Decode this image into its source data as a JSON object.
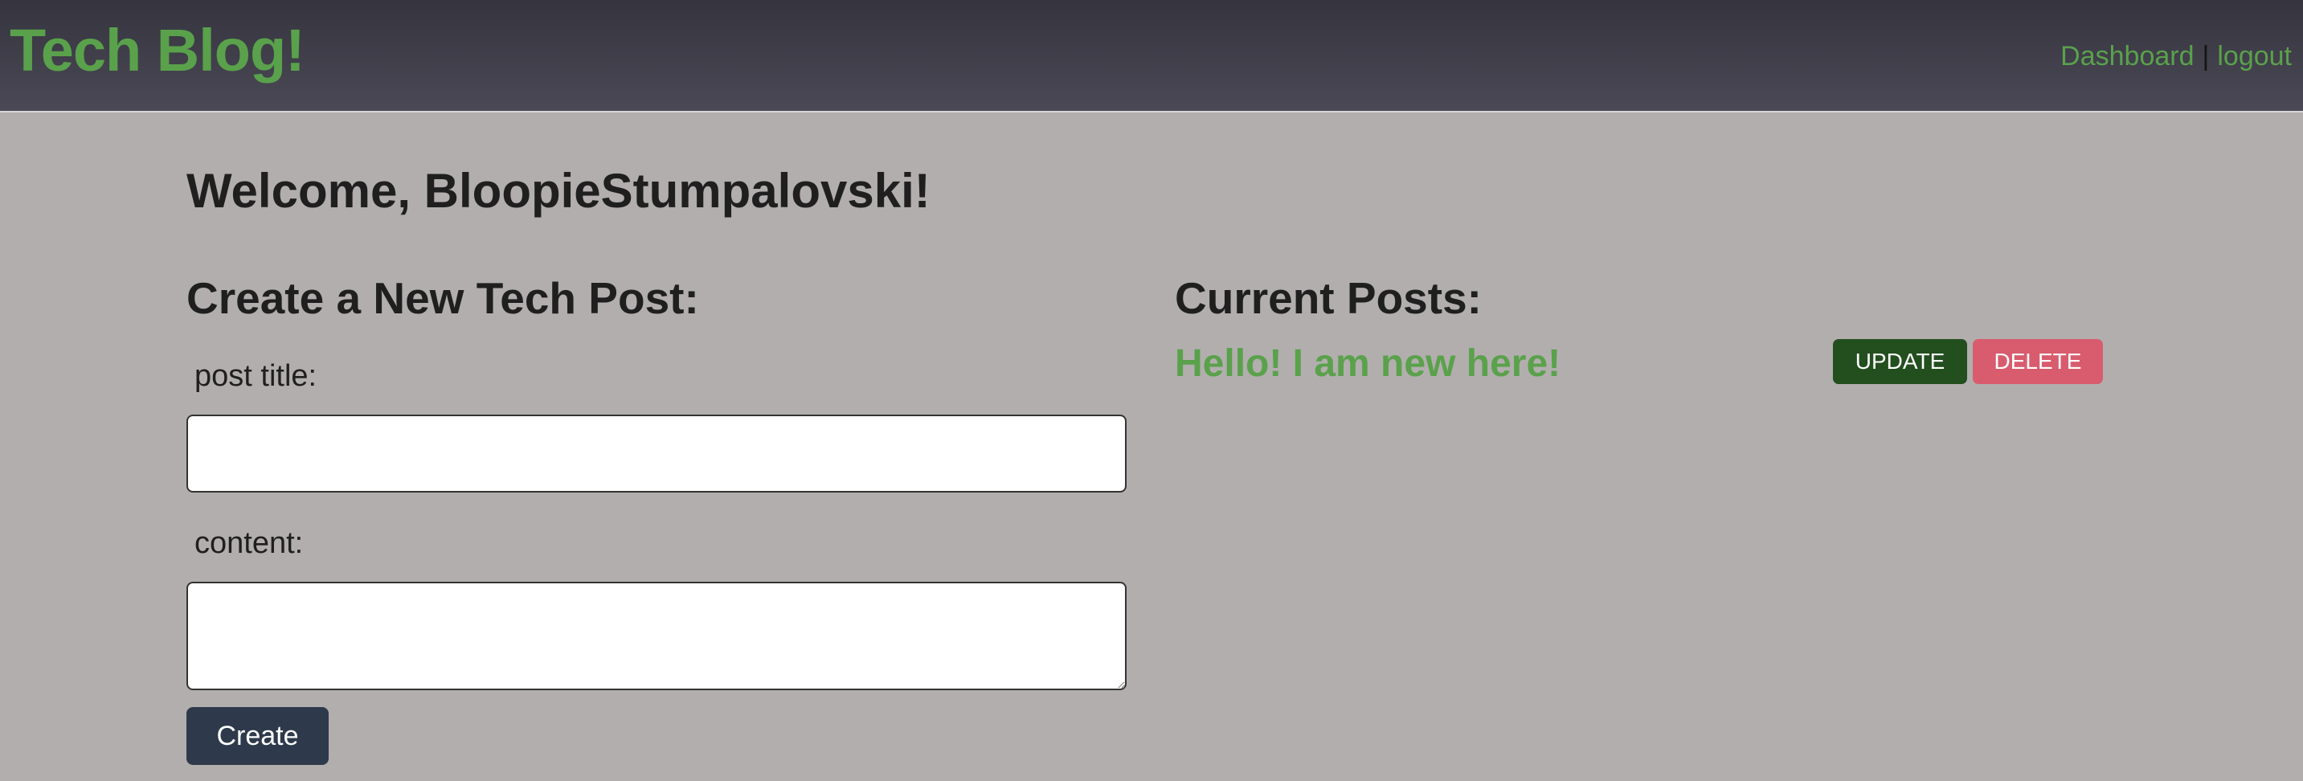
{
  "header": {
    "brand": "Tech Blog!",
    "nav": {
      "dashboard": "Dashboard",
      "separator": "|",
      "logout": "logout"
    }
  },
  "main": {
    "welcome": "Welcome, BloopieStumpalovski!",
    "create_section": {
      "heading": "Create a New Tech Post:",
      "title_label": "post title:",
      "title_value": "",
      "content_label": "content:",
      "content_value": "",
      "submit_label": "Create"
    },
    "posts_section": {
      "heading": "Current Posts:",
      "posts": [
        {
          "title": "Hello! I am new here!",
          "update_label": "UPDATE",
          "delete_label": "DELETE"
        }
      ]
    }
  },
  "colors": {
    "accent_green": "#5aa14b",
    "header_bg": "#35343f",
    "page_bg": "#b2aeae",
    "create_button": "#2e3a4b",
    "update_button": "#234f1e",
    "delete_button": "#d85c6e"
  }
}
